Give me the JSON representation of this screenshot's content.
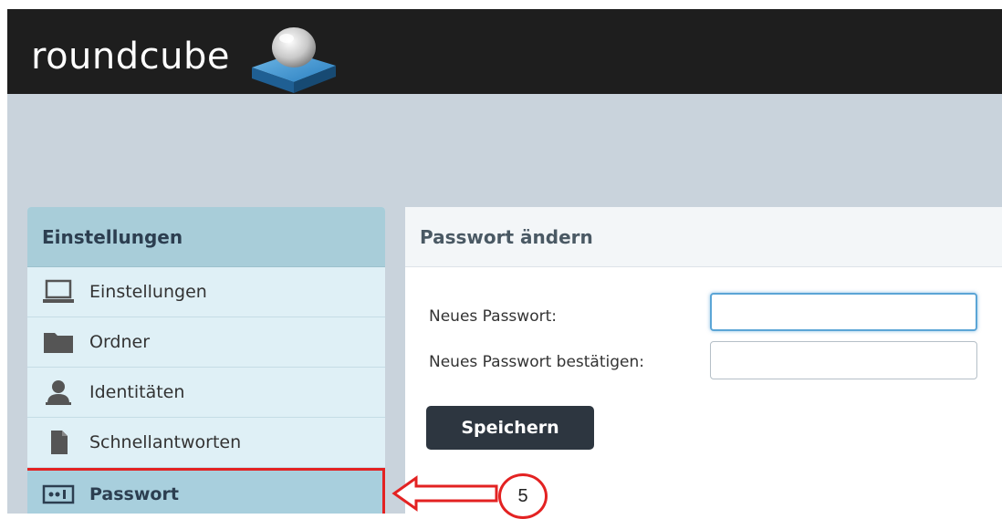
{
  "app": {
    "brand": "roundcube",
    "brand_color": "#1e1e1e",
    "accent_color": "#a8cfdd"
  },
  "sidebar": {
    "title": "Einstellungen",
    "items": [
      {
        "label": "Einstellungen",
        "icon": "laptop-icon",
        "active": false
      },
      {
        "label": "Ordner",
        "icon": "folder-icon",
        "active": false
      },
      {
        "label": "Identitäten",
        "icon": "user-icon",
        "active": false
      },
      {
        "label": "Schnellantworten",
        "icon": "document-icon",
        "active": false
      },
      {
        "label": "Passwort",
        "icon": "password-icon",
        "active": true
      }
    ]
  },
  "main": {
    "title": "Passwort ändern",
    "fields": [
      {
        "label": "Neues Passwort:",
        "value": "",
        "focused": true
      },
      {
        "label": "Neues Passwort bestätigen:",
        "value": "",
        "focused": false
      }
    ],
    "save_label": "Speichern"
  },
  "annotation": {
    "step_number": "5",
    "highlight_color": "#e32222"
  }
}
